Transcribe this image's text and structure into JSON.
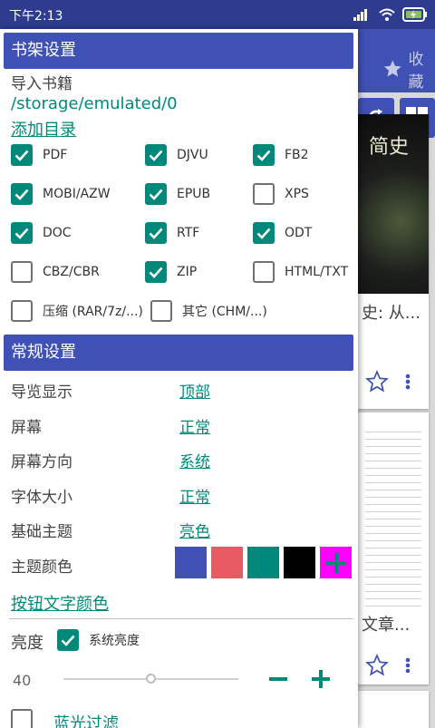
{
  "status_bar": {
    "time": "下午2:13"
  },
  "background": {
    "favorites_label": "收藏",
    "card1": {
      "cover_text": "简史",
      "title": "史: 从..."
    },
    "card2": {
      "title": "文章..."
    }
  },
  "bookshelf": {
    "header": "书架设置",
    "import_label": "导入书籍",
    "path": "/storage/emulated/0",
    "add_dir": "添加目录",
    "formats": [
      {
        "label": "PDF",
        "checked": true
      },
      {
        "label": "DJVU",
        "checked": true
      },
      {
        "label": "FB2",
        "checked": true
      },
      {
        "label": "MOBI/AZW",
        "checked": true
      },
      {
        "label": "EPUB",
        "checked": true
      },
      {
        "label": "XPS",
        "checked": false
      },
      {
        "label": "DOC",
        "checked": true
      },
      {
        "label": "RTF",
        "checked": true
      },
      {
        "label": "ODT",
        "checked": true
      },
      {
        "label": "CBZ/CBR",
        "checked": false
      },
      {
        "label": "ZIP",
        "checked": true
      },
      {
        "label": "HTML/TXT",
        "checked": false
      },
      {
        "label": "压缩 (RAR/7z/...)",
        "checked": false
      },
      {
        "label": "其它 (CHM/...)",
        "checked": false
      }
    ]
  },
  "general": {
    "header": "常规设置",
    "rows": [
      {
        "label": "导览显示",
        "value": "顶部"
      },
      {
        "label": "屏幕",
        "value": "正常"
      },
      {
        "label": "屏幕方向",
        "value": "系统"
      },
      {
        "label": "字体大小",
        "value": "正常"
      },
      {
        "label": "基础主题",
        "value": "亮色"
      }
    ],
    "theme_color_label": "主题颜色",
    "theme_colors": [
      "#3f51b5",
      "#e95b63",
      "#00897b",
      "#000000"
    ],
    "add_color_bg": "#ff00ff",
    "button_text_color": "按钮文字颜色",
    "brightness_label": "亮度",
    "system_brightness": "系统亮度",
    "system_brightness_checked": true,
    "brightness_value": "40",
    "brightness_level": 0.5,
    "blue_light_filter": "蓝光过滤",
    "blue_light_checked": false
  },
  "colors": {
    "accent": "#00897b",
    "primary": "#3f51b5"
  }
}
